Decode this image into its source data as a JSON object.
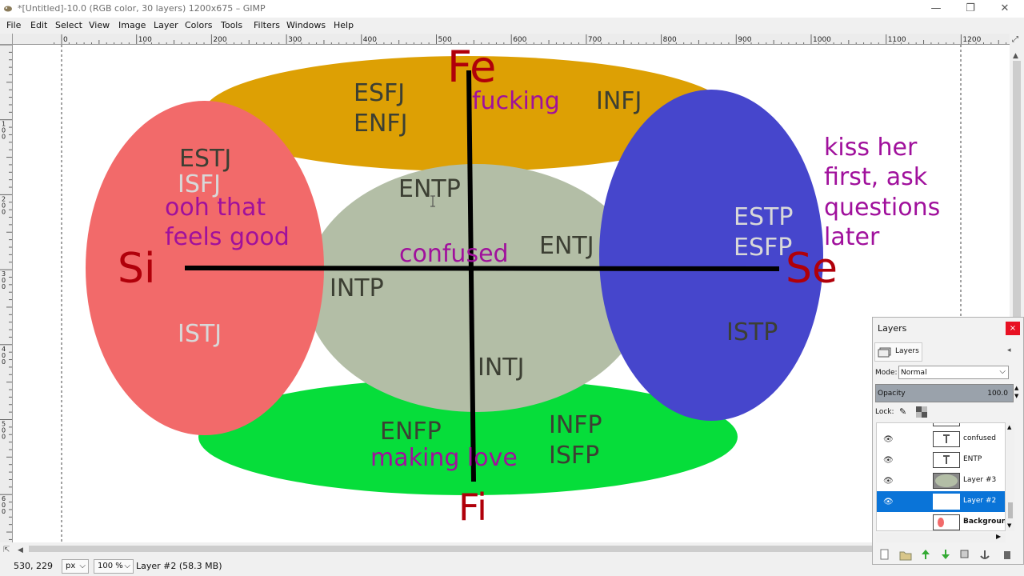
{
  "window": {
    "title": "*[Untitled]-10.0 (RGB color, 30 layers) 1200x675 – GIMP",
    "minimize_glyph": "—",
    "restore_glyph": "❐",
    "close_glyph": "✕"
  },
  "menu": [
    "File",
    "Edit",
    "Select",
    "View",
    "Image",
    "Layer",
    "Colors",
    "Tools",
    "Filters",
    "Windows",
    "Help"
  ],
  "ruler": {
    "h_ticks": [
      "0",
      "100",
      "200",
      "300",
      "400",
      "500",
      "600",
      "700",
      "800",
      "900",
      "1000",
      "1100",
      "1200"
    ],
    "v_ticks": [
      "1\n0\n0",
      "2\n0\n0",
      "3\n0\n0",
      "4\n0\n0",
      "5\n0\n0",
      "6\n0\n0"
    ]
  },
  "canvas": {
    "labels": {
      "fe": "Fe",
      "fi": "Fi",
      "si": "Si",
      "se": "Se",
      "esfj": "ESFJ",
      "enfj": "ENFJ",
      "fucking": "fucking",
      "infj": "INFJ",
      "estj": "ESTJ",
      "isfj": "ISFJ",
      "ooh1": "ooh that",
      "ooh2": "feels good",
      "istj": "ISTJ",
      "entp": "ENTP",
      "confused": "confused",
      "entj": "ENTJ",
      "intp": "INTP",
      "intj": "INTJ",
      "estp": "ESTP",
      "esfp": "ESFP",
      "istp": "ISTP",
      "kiss1": "kiss her",
      "kiss2": "first, ask",
      "kiss3": "questions",
      "kiss4": "later",
      "enfp": "ENFP",
      "making": "making love",
      "infp": "INFP",
      "isfp": "ISFP"
    },
    "colors": {
      "top_ellipse": "#dda004",
      "left_ellipse": "#f26a6a",
      "center_ellipse": "#b3bea6",
      "right_ellipse": "#4646cc",
      "bottom_ellipse": "#06dd3a",
      "dark_red": "#b0000a",
      "purple": "#a0109c",
      "dark_text": "#3c3f33",
      "pale_text": "#d8d8d8"
    }
  },
  "status": {
    "coords": "530, 229",
    "unit": "px",
    "zoom": "100 %",
    "layer_info": "Layer #2 (58.3 MB)"
  },
  "layers_panel": {
    "title": "Layers",
    "tab": "Layers",
    "mode_label": "Mode:",
    "mode_value": "Normal",
    "opacity_label": "Opacity",
    "opacity_value": "100.0",
    "lock_label": "Lock:",
    "items": [
      {
        "name": "confused",
        "visible": true,
        "selected": false
      },
      {
        "name": "ENTP",
        "visible": true,
        "selected": false
      },
      {
        "name": "Layer #3",
        "visible": true,
        "selected": false
      },
      {
        "name": "Layer #2",
        "visible": true,
        "selected": true
      },
      {
        "name": "Background",
        "visible": false,
        "selected": false
      }
    ]
  }
}
